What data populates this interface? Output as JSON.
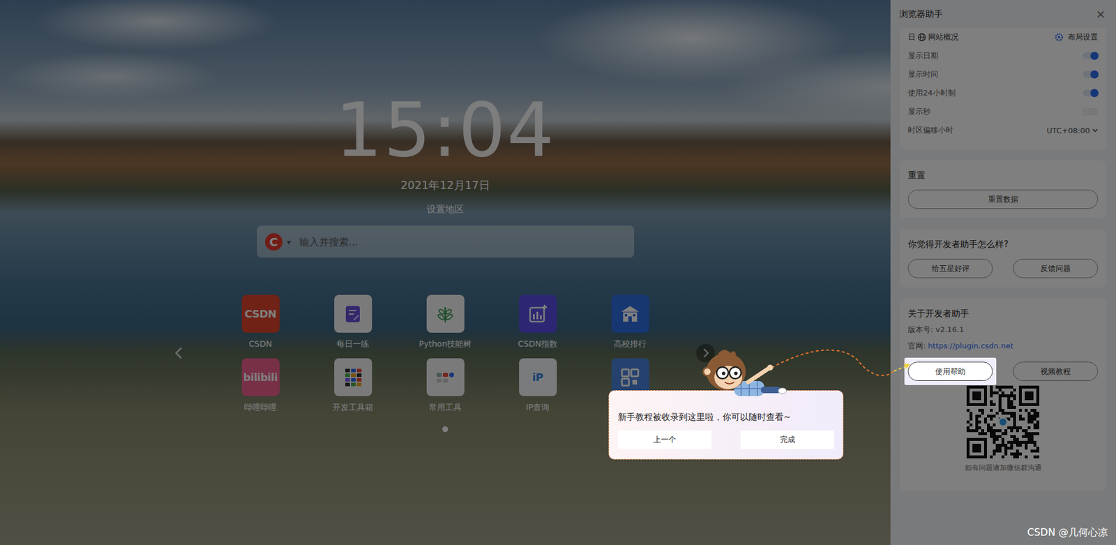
{
  "clock": {
    "time": "15:04",
    "date": "2021年12月17日",
    "region": "设置地区"
  },
  "search": {
    "engine_letter": "C",
    "dropdown": "▾",
    "placeholder": "输入并搜索..."
  },
  "shortcuts": [
    {
      "label": "CSDN",
      "kind": "text",
      "icon_text": "CSDN",
      "color": "#e0452f"
    },
    {
      "label": "每日一练",
      "kind": "doc",
      "color": "#f4f4f6"
    },
    {
      "label": "Python技能树",
      "kind": "leaf",
      "color": "#f4f6f4"
    },
    {
      "label": "CSDN指数",
      "kind": "chart",
      "color": "#5b4ee6"
    },
    {
      "label": "高校排行",
      "kind": "building",
      "color": "#2f6fe4"
    },
    {
      "label": "哔哩哔哩",
      "kind": "text",
      "icon_text": "bilibili",
      "color": "#f0608f"
    },
    {
      "label": "开发工具箱",
      "kind": "tools",
      "color": "#f4f4f6"
    },
    {
      "label": "常用工具",
      "kind": "apps",
      "color": "#f4f4f6"
    },
    {
      "label": "IP查询",
      "kind": "text",
      "icon_text": "iP",
      "color": "#f4f6f8"
    },
    {
      "kind": "qr",
      "color": "#4a82dc"
    }
  ],
  "pager": [
    {
      "selected": true
    }
  ],
  "panel": {
    "title": "浏览器助手",
    "close": "×",
    "header": {
      "left_fragment": "日",
      "label": "网站概况",
      "layout_label": "布局设置"
    },
    "settings": [
      {
        "label": "显示日期",
        "kind": "toggle",
        "on": true
      },
      {
        "label": "显示时间",
        "kind": "toggle",
        "on": true
      },
      {
        "label": "使用24小时制",
        "kind": "toggle",
        "on": true
      },
      {
        "label": "显示秒",
        "kind": "toggle",
        "on": false
      },
      {
        "label": "时区偏移小时",
        "kind": "select",
        "value": "UTC+08:00"
      }
    ],
    "reset": {
      "title": "重置",
      "button": "重置数据"
    },
    "feedback": {
      "title": "你觉得开发者助手怎么样?",
      "buttons": [
        "给五星好评",
        "反馈问题"
      ]
    },
    "about": {
      "title": "关于开发者助手",
      "version": "版本号: v2.16.1",
      "site_label": "官网: ",
      "site_url": "https://plugin.csdn.net",
      "buttons": [
        {
          "label": "使用帮助",
          "highlighted": true
        },
        {
          "label": "视频教程",
          "highlighted": false
        }
      ],
      "qr_caption": "如有问题请加微信群沟通"
    }
  },
  "tour": {
    "message": "新手教程被收录到这里啦，你可以随时查看~",
    "buttons": [
      "上一个",
      "完成"
    ]
  },
  "watermark": "CSDN @几何心凉"
}
